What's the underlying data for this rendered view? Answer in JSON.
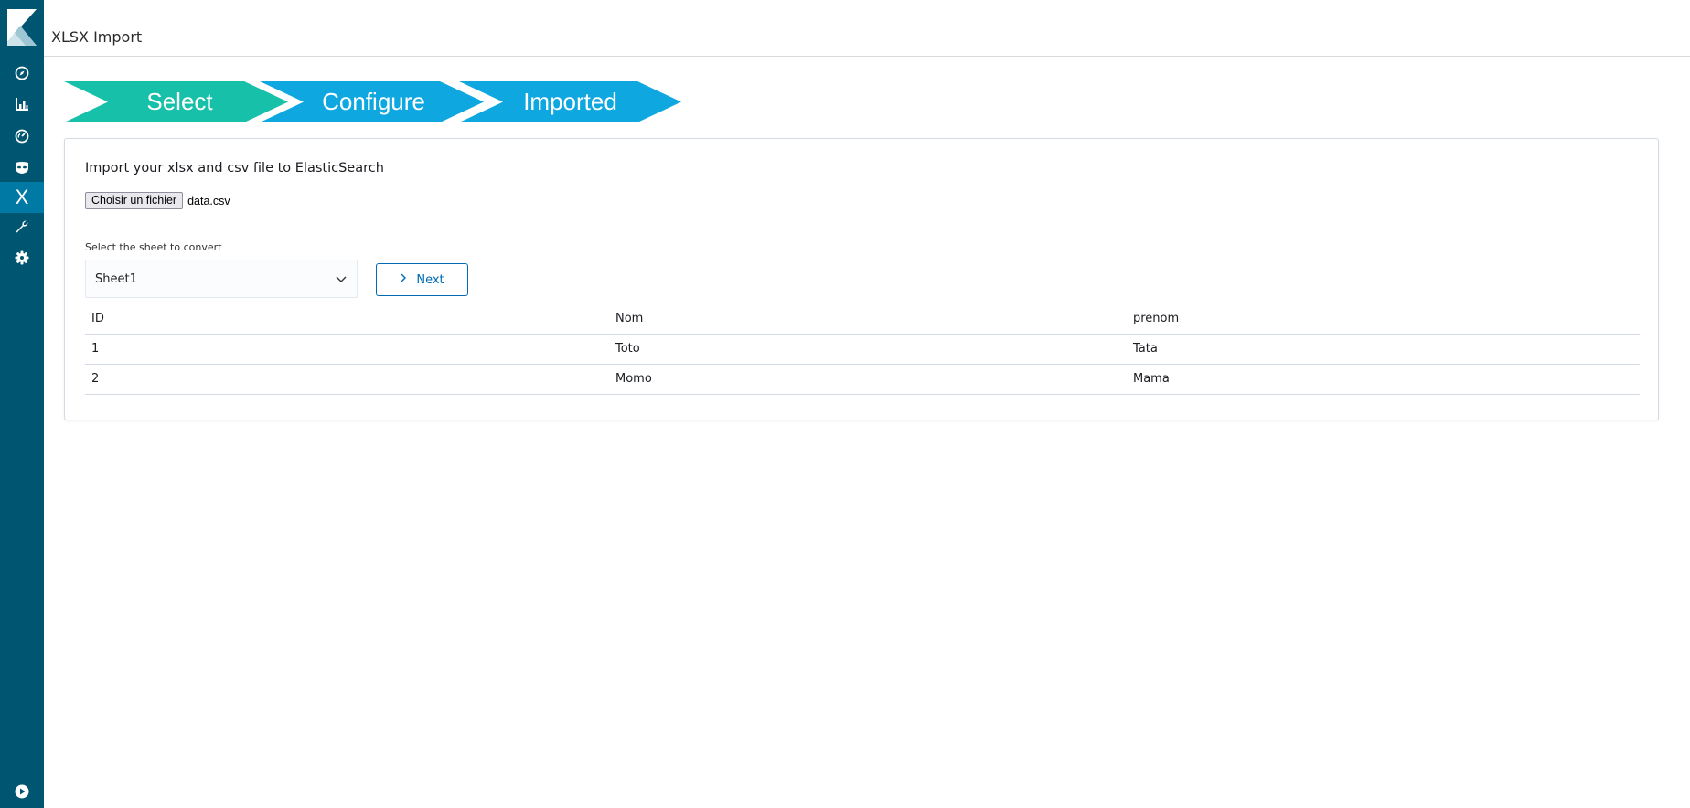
{
  "app": {
    "title": "XLSX Import"
  },
  "sidebar": {
    "items": [
      {
        "name": "discover",
        "icon": "compass-icon"
      },
      {
        "name": "visualize",
        "icon": "bar-chart-icon"
      },
      {
        "name": "dashboard",
        "icon": "gauge-icon"
      },
      {
        "name": "timelion",
        "icon": "mask-icon"
      },
      {
        "name": "xlsx-import",
        "icon": "x-icon",
        "label": "X",
        "active": true
      },
      {
        "name": "dev-tools",
        "icon": "wrench-icon"
      },
      {
        "name": "management",
        "icon": "gear-icon"
      },
      {
        "name": "collapse",
        "icon": "play-circle-icon"
      }
    ],
    "background": "#005571",
    "active_color": "#0079a5"
  },
  "steps": [
    {
      "label": "Select",
      "color": "#17c0a8"
    },
    {
      "label": "Configure",
      "color": "#0ea7e0"
    },
    {
      "label": "Imported",
      "color": "#0ea7e0"
    }
  ],
  "panel": {
    "title": "Import your xlsx and csv file to ElasticSearch",
    "file_button_label": "Choisir un fichier",
    "file_name": "data.csv",
    "sheet_label": "Select the sheet to convert",
    "sheet_selected": "Sheet1",
    "next_label": "Next"
  },
  "table": {
    "headers": [
      "ID",
      "Nom",
      "prenom"
    ],
    "rows": [
      [
        "1",
        "Toto",
        "Tata"
      ],
      [
        "2",
        "Momo",
        "Mama"
      ]
    ]
  }
}
